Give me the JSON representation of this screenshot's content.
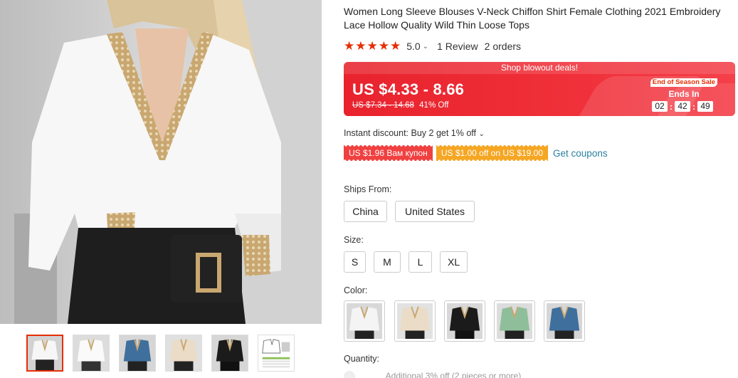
{
  "product": {
    "title": "Women Long Sleeve Blouses V-Neck Chiffon Shirt Female Clothing 2021 Embroidery Lace Hollow Quality Wild Thin Loose Tops",
    "rating": 5.0,
    "rating_text": "5.0",
    "stars": "★★★★★",
    "reviews": "1 Review",
    "orders": "2 orders"
  },
  "price": {
    "banner": "Shop blowout deals!",
    "current": "US $4.33 - 8.66",
    "original": "US $7.34 - 14.68",
    "discount": "41% Off",
    "sale_tag": "End of Season Sale",
    "ends_in": "Ends In",
    "timer": {
      "hours": "02",
      "minutes": "42",
      "seconds": "49"
    }
  },
  "instant_discount": "Instant discount: Buy 2 get 1% off",
  "coupons": {
    "coupon1": "US $1.96 Вам купон",
    "coupon2": "US $1.00 off on US $19.00",
    "get_coupons": "Get coupons"
  },
  "ships_from": {
    "label": "Ships From:",
    "options": [
      "China",
      "United States"
    ]
  },
  "size": {
    "label": "Size:",
    "options": [
      "S",
      "M",
      "L",
      "XL"
    ]
  },
  "color": {
    "label": "Color:",
    "swatches": [
      {
        "name": "white",
        "shirt": "#f4f4f4",
        "trim": "#c9a770"
      },
      {
        "name": "apricot",
        "shirt": "#eadcc6",
        "trim": "#c9a770"
      },
      {
        "name": "black",
        "shirt": "#1b1b1b",
        "trim": "#c9a770"
      },
      {
        "name": "green",
        "shirt": "#8fbf9a",
        "trim": "#c9a770"
      },
      {
        "name": "blue",
        "shirt": "#3f6f9c",
        "trim": "#c9a770"
      }
    ]
  },
  "quantity": {
    "label": "Quantity:",
    "extra": "Additional 3% off (2 pieces or more)"
  },
  "gallery": {
    "thumbnails": [
      "white",
      "white-alt",
      "blue",
      "apricot",
      "black",
      "size-chart"
    ],
    "active": 0
  },
  "colors": {
    "accent": "#e62e04",
    "price_bg": "#ef2b36",
    "link": "#2a7f9e",
    "coupon_red": "#f04040",
    "coupon_orange": "#f5a623"
  }
}
